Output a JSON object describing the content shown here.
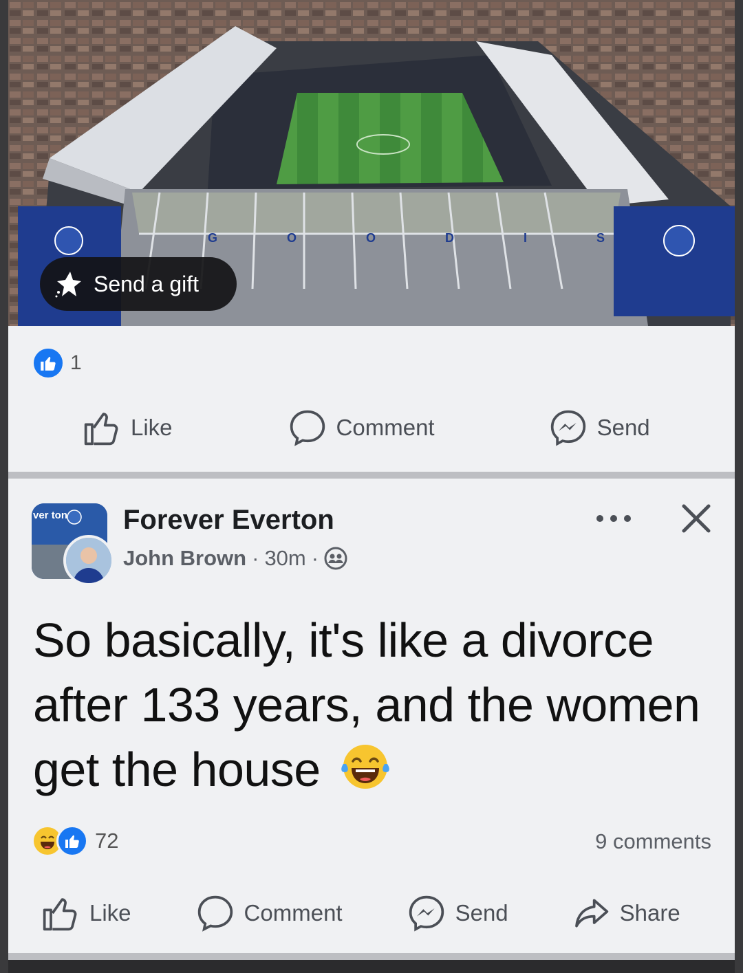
{
  "top_post": {
    "image_description": "aerial-stadium-photo",
    "stand_lettering": "G O O D I S O N",
    "gift_button_label": "Send a gift",
    "reaction_count": "1",
    "actions": {
      "like": "Like",
      "comment": "Comment",
      "send": "Send"
    }
  },
  "second_post": {
    "group_name": "Forever Everton",
    "group_avatar_text": "ver ton",
    "author": "John Brown",
    "time": "30m",
    "separator": "·",
    "privacy_icon": "group-icon",
    "text": "So basically,  it's like a divorce after 133 years, and the women get the house",
    "emoji": "laughing-tears-emoji",
    "reaction_count": "72",
    "comments_label": "9 comments",
    "actions": {
      "like": "Like",
      "comment": "Comment",
      "send": "Send",
      "share": "Share"
    }
  },
  "colors": {
    "card_bg": "#f0f1f3",
    "divider": "#bdbec2",
    "like_blue": "#1877f2",
    "everton_blue": "#1f3c8f",
    "text_secondary": "#5b5f66"
  }
}
